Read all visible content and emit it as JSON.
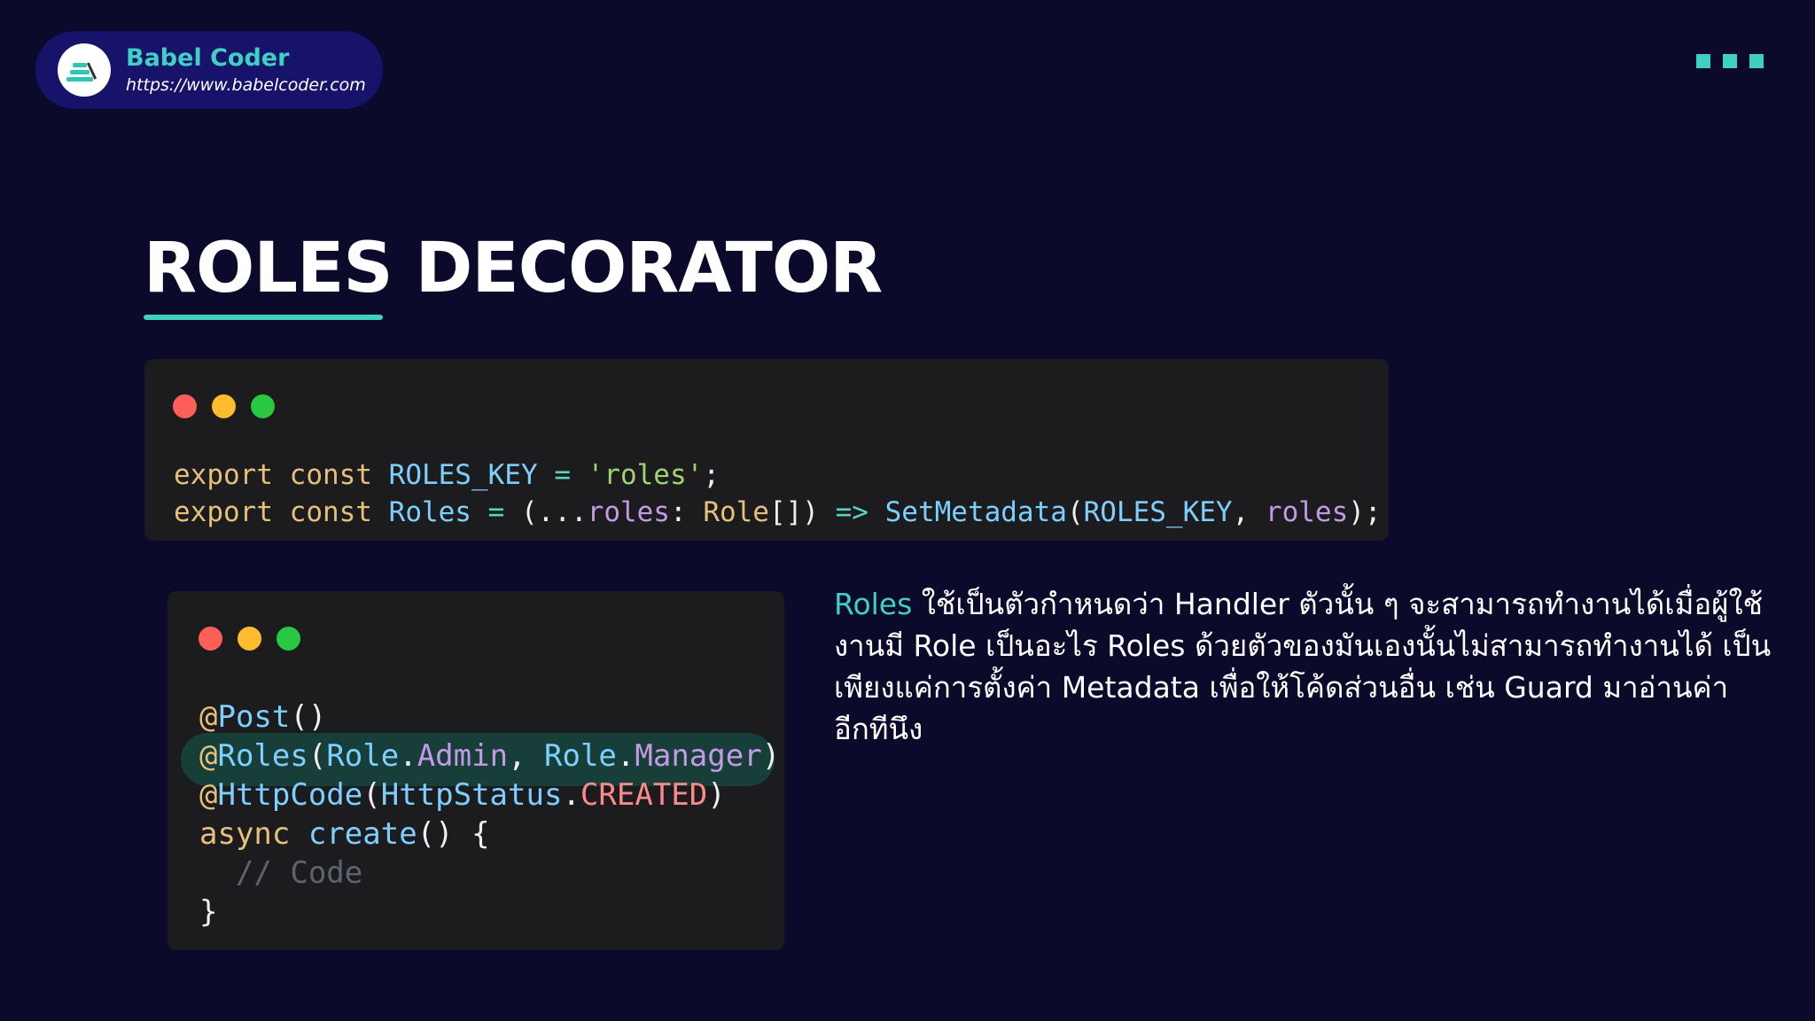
{
  "brand": {
    "name": "Babel Coder",
    "url": "https://www.babelcoder.com",
    "logo_icon": "babel-coder-logo-icon",
    "accent_color": "#3fd0c4",
    "pill_color": "#17126a"
  },
  "menu": {
    "icon": "three-squares-menu-icon"
  },
  "slide": {
    "title": "ROLES DECORATOR",
    "background_color": "#0c0a2a"
  },
  "code_block_1": {
    "lines": [
      [
        {
          "t": "export",
          "k": "kw"
        },
        {
          "t": " ",
          "k": "p"
        },
        {
          "t": "const",
          "k": "kw"
        },
        {
          "t": " ",
          "k": "p"
        },
        {
          "t": "ROLES_KEY",
          "k": "var"
        },
        {
          "t": " ",
          "k": "p"
        },
        {
          "t": "=",
          "k": "op"
        },
        {
          "t": " ",
          "k": "p"
        },
        {
          "t": "'roles'",
          "k": "str"
        },
        {
          "t": ";",
          "k": "p"
        }
      ],
      [
        {
          "t": "export",
          "k": "kw"
        },
        {
          "t": " ",
          "k": "p"
        },
        {
          "t": "const",
          "k": "kw"
        },
        {
          "t": " ",
          "k": "p"
        },
        {
          "t": "Roles",
          "k": "var"
        },
        {
          "t": " ",
          "k": "p"
        },
        {
          "t": "=",
          "k": "op"
        },
        {
          "t": " ",
          "k": "p"
        },
        {
          "t": "(...",
          "k": "p"
        },
        {
          "t": "roles",
          "k": "param"
        },
        {
          "t": ": ",
          "k": "p"
        },
        {
          "t": "Role",
          "k": "type"
        },
        {
          "t": "[]) ",
          "k": "p"
        },
        {
          "t": "=>",
          "k": "op"
        },
        {
          "t": " ",
          "k": "p"
        },
        {
          "t": "SetMetadata",
          "k": "fn"
        },
        {
          "t": "(",
          "k": "p"
        },
        {
          "t": "ROLES_KEY",
          "k": "var"
        },
        {
          "t": ", ",
          "k": "p"
        },
        {
          "t": "roles",
          "k": "param"
        },
        {
          "t": ");",
          "k": "p"
        }
      ]
    ]
  },
  "code_block_2": {
    "highlighted_line_index": 1,
    "lines": [
      [
        {
          "t": "@",
          "k": "at"
        },
        {
          "t": "Post",
          "k": "dec"
        },
        {
          "t": "()",
          "k": "p"
        }
      ],
      [
        {
          "t": "@",
          "k": "at"
        },
        {
          "t": "Roles",
          "k": "dec"
        },
        {
          "t": "(",
          "k": "p"
        },
        {
          "t": "Role",
          "k": "var"
        },
        {
          "t": ".",
          "k": "p"
        },
        {
          "t": "Admin",
          "k": "member"
        },
        {
          "t": ", ",
          "k": "p"
        },
        {
          "t": "Role",
          "k": "var"
        },
        {
          "t": ".",
          "k": "p"
        },
        {
          "t": "Manager",
          "k": "member"
        },
        {
          "t": ")",
          "k": "p"
        }
      ],
      [
        {
          "t": "@",
          "k": "at"
        },
        {
          "t": "HttpCode",
          "k": "dec"
        },
        {
          "t": "(",
          "k": "p"
        },
        {
          "t": "HttpStatus",
          "k": "var"
        },
        {
          "t": ".",
          "k": "p"
        },
        {
          "t": "CREATED",
          "k": "const"
        },
        {
          "t": ")",
          "k": "p"
        }
      ],
      [
        {
          "t": "async",
          "k": "kw"
        },
        {
          "t": " ",
          "k": "p"
        },
        {
          "t": "create",
          "k": "fn"
        },
        {
          "t": "() {",
          "k": "p"
        }
      ],
      [
        {
          "t": "  // Code",
          "k": "cm"
        }
      ],
      [
        {
          "t": "}",
          "k": "p"
        }
      ]
    ]
  },
  "description": {
    "accent_word": "Roles",
    "line_1_rest": " ใช้เป็นตัวกำหนดว่า Handler ตัวนั้น ๆ จะสามารถทำงานได้เมื่อผู้ใช้",
    "line_2": "งานมี Role เป็นอะไร Roles ด้วยตัวของมันเองนั้นไม่สามารถทำงานได้ เป็น",
    "line_3": "เพียงแค่การตั้งค่า Metadata เพื่อให้โค้ดส่วนอื่น เช่น Guard มาอ่านค่า",
    "line_4": "อีกทีนึง"
  }
}
